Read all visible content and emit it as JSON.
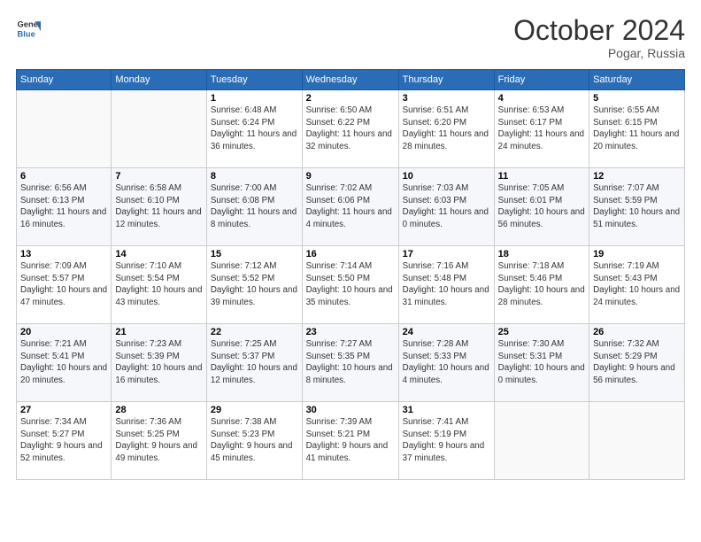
{
  "header": {
    "logo_line1": "General",
    "logo_line2": "Blue",
    "month": "October 2024",
    "location": "Pogar, Russia"
  },
  "weekdays": [
    "Sunday",
    "Monday",
    "Tuesday",
    "Wednesday",
    "Thursday",
    "Friday",
    "Saturday"
  ],
  "weeks": [
    [
      {
        "day": "",
        "sunrise": "",
        "sunset": "",
        "daylight": ""
      },
      {
        "day": "",
        "sunrise": "",
        "sunset": "",
        "daylight": ""
      },
      {
        "day": "1",
        "sunrise": "Sunrise: 6:48 AM",
        "sunset": "Sunset: 6:24 PM",
        "daylight": "Daylight: 11 hours and 36 minutes."
      },
      {
        "day": "2",
        "sunrise": "Sunrise: 6:50 AM",
        "sunset": "Sunset: 6:22 PM",
        "daylight": "Daylight: 11 hours and 32 minutes."
      },
      {
        "day": "3",
        "sunrise": "Sunrise: 6:51 AM",
        "sunset": "Sunset: 6:20 PM",
        "daylight": "Daylight: 11 hours and 28 minutes."
      },
      {
        "day": "4",
        "sunrise": "Sunrise: 6:53 AM",
        "sunset": "Sunset: 6:17 PM",
        "daylight": "Daylight: 11 hours and 24 minutes."
      },
      {
        "day": "5",
        "sunrise": "Sunrise: 6:55 AM",
        "sunset": "Sunset: 6:15 PM",
        "daylight": "Daylight: 11 hours and 20 minutes."
      }
    ],
    [
      {
        "day": "6",
        "sunrise": "Sunrise: 6:56 AM",
        "sunset": "Sunset: 6:13 PM",
        "daylight": "Daylight: 11 hours and 16 minutes."
      },
      {
        "day": "7",
        "sunrise": "Sunrise: 6:58 AM",
        "sunset": "Sunset: 6:10 PM",
        "daylight": "Daylight: 11 hours and 12 minutes."
      },
      {
        "day": "8",
        "sunrise": "Sunrise: 7:00 AM",
        "sunset": "Sunset: 6:08 PM",
        "daylight": "Daylight: 11 hours and 8 minutes."
      },
      {
        "day": "9",
        "sunrise": "Sunrise: 7:02 AM",
        "sunset": "Sunset: 6:06 PM",
        "daylight": "Daylight: 11 hours and 4 minutes."
      },
      {
        "day": "10",
        "sunrise": "Sunrise: 7:03 AM",
        "sunset": "Sunset: 6:03 PM",
        "daylight": "Daylight: 11 hours and 0 minutes."
      },
      {
        "day": "11",
        "sunrise": "Sunrise: 7:05 AM",
        "sunset": "Sunset: 6:01 PM",
        "daylight": "Daylight: 10 hours and 56 minutes."
      },
      {
        "day": "12",
        "sunrise": "Sunrise: 7:07 AM",
        "sunset": "Sunset: 5:59 PM",
        "daylight": "Daylight: 10 hours and 51 minutes."
      }
    ],
    [
      {
        "day": "13",
        "sunrise": "Sunrise: 7:09 AM",
        "sunset": "Sunset: 5:57 PM",
        "daylight": "Daylight: 10 hours and 47 minutes."
      },
      {
        "day": "14",
        "sunrise": "Sunrise: 7:10 AM",
        "sunset": "Sunset: 5:54 PM",
        "daylight": "Daylight: 10 hours and 43 minutes."
      },
      {
        "day": "15",
        "sunrise": "Sunrise: 7:12 AM",
        "sunset": "Sunset: 5:52 PM",
        "daylight": "Daylight: 10 hours and 39 minutes."
      },
      {
        "day": "16",
        "sunrise": "Sunrise: 7:14 AM",
        "sunset": "Sunset: 5:50 PM",
        "daylight": "Daylight: 10 hours and 35 minutes."
      },
      {
        "day": "17",
        "sunrise": "Sunrise: 7:16 AM",
        "sunset": "Sunset: 5:48 PM",
        "daylight": "Daylight: 10 hours and 31 minutes."
      },
      {
        "day": "18",
        "sunrise": "Sunrise: 7:18 AM",
        "sunset": "Sunset: 5:46 PM",
        "daylight": "Daylight: 10 hours and 28 minutes."
      },
      {
        "day": "19",
        "sunrise": "Sunrise: 7:19 AM",
        "sunset": "Sunset: 5:43 PM",
        "daylight": "Daylight: 10 hours and 24 minutes."
      }
    ],
    [
      {
        "day": "20",
        "sunrise": "Sunrise: 7:21 AM",
        "sunset": "Sunset: 5:41 PM",
        "daylight": "Daylight: 10 hours and 20 minutes."
      },
      {
        "day": "21",
        "sunrise": "Sunrise: 7:23 AM",
        "sunset": "Sunset: 5:39 PM",
        "daylight": "Daylight: 10 hours and 16 minutes."
      },
      {
        "day": "22",
        "sunrise": "Sunrise: 7:25 AM",
        "sunset": "Sunset: 5:37 PM",
        "daylight": "Daylight: 10 hours and 12 minutes."
      },
      {
        "day": "23",
        "sunrise": "Sunrise: 7:27 AM",
        "sunset": "Sunset: 5:35 PM",
        "daylight": "Daylight: 10 hours and 8 minutes."
      },
      {
        "day": "24",
        "sunrise": "Sunrise: 7:28 AM",
        "sunset": "Sunset: 5:33 PM",
        "daylight": "Daylight: 10 hours and 4 minutes."
      },
      {
        "day": "25",
        "sunrise": "Sunrise: 7:30 AM",
        "sunset": "Sunset: 5:31 PM",
        "daylight": "Daylight: 10 hours and 0 minutes."
      },
      {
        "day": "26",
        "sunrise": "Sunrise: 7:32 AM",
        "sunset": "Sunset: 5:29 PM",
        "daylight": "Daylight: 9 hours and 56 minutes."
      }
    ],
    [
      {
        "day": "27",
        "sunrise": "Sunrise: 7:34 AM",
        "sunset": "Sunset: 5:27 PM",
        "daylight": "Daylight: 9 hours and 52 minutes."
      },
      {
        "day": "28",
        "sunrise": "Sunrise: 7:36 AM",
        "sunset": "Sunset: 5:25 PM",
        "daylight": "Daylight: 9 hours and 49 minutes."
      },
      {
        "day": "29",
        "sunrise": "Sunrise: 7:38 AM",
        "sunset": "Sunset: 5:23 PM",
        "daylight": "Daylight: 9 hours and 45 minutes."
      },
      {
        "day": "30",
        "sunrise": "Sunrise: 7:39 AM",
        "sunset": "Sunset: 5:21 PM",
        "daylight": "Daylight: 9 hours and 41 minutes."
      },
      {
        "day": "31",
        "sunrise": "Sunrise: 7:41 AM",
        "sunset": "Sunset: 5:19 PM",
        "daylight": "Daylight: 9 hours and 37 minutes."
      },
      {
        "day": "",
        "sunrise": "",
        "sunset": "",
        "daylight": ""
      },
      {
        "day": "",
        "sunrise": "",
        "sunset": "",
        "daylight": ""
      }
    ]
  ]
}
